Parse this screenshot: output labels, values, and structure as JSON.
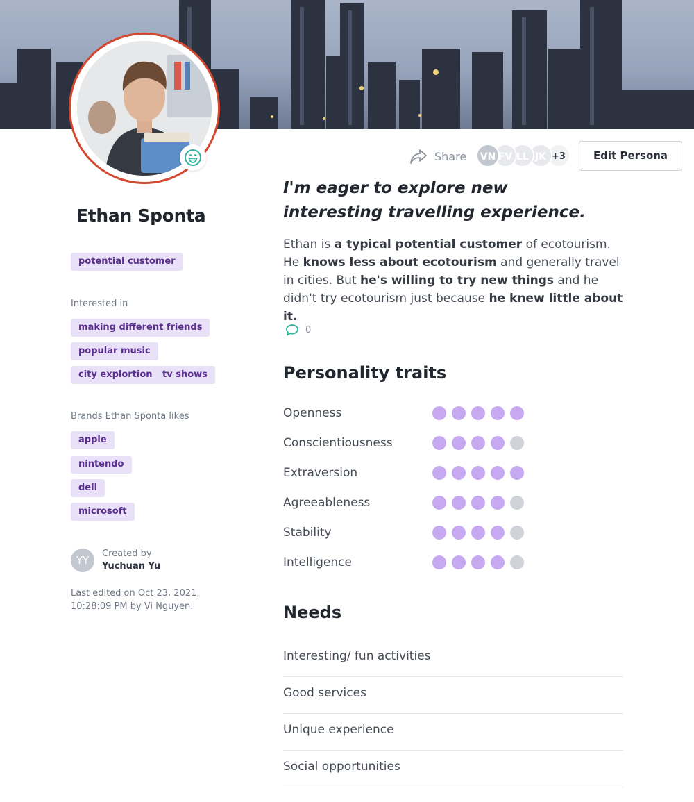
{
  "profile": {
    "name": "Ethan Sponta",
    "type_tag": "potential customer",
    "interested_label": "Interested in",
    "interests": [
      "making different friends",
      "popular music",
      "city explortion",
      "tv shows"
    ],
    "brands_label": "Brands Ethan Sponta likes",
    "brands": [
      "apple",
      "nintendo",
      "dell",
      "microsoft"
    ],
    "mood_icon": "grin-face-icon"
  },
  "creator": {
    "initials": "YY",
    "label": "Created by",
    "name": "Yuchuan Yu",
    "edited": "Last edited on Oct 23, 2021, 10:28:09 PM by Vi Nguyen."
  },
  "toolbar": {
    "share_label": "Share",
    "collaborators": [
      {
        "initials": "VN",
        "color": "#c3c8d0"
      },
      {
        "initials": "FV",
        "color": "#e7e9ec"
      },
      {
        "initials": "LL",
        "color": "#e7e9ec"
      },
      {
        "initials": "JK",
        "color": "#e7e9ec"
      }
    ],
    "more_count": "+3",
    "edit_label": "Edit Persona"
  },
  "quote": "I'm eager to explore new interesting travelling experience.",
  "description": {
    "s1": "Ethan is ",
    "b1": "a typical potential customer",
    "s2": " of ecotourism. He ",
    "b2": "knows less about ecotourism",
    "s3": " and generally travel in cities. But ",
    "b3": "he's willing to try new things",
    "s4": " and he didn't try ecotourism just because ",
    "b4": "he knew little about it."
  },
  "comments": {
    "count": "0"
  },
  "personality": {
    "title": "Personality traits",
    "max": 5,
    "filled_color": "#c6a9f0",
    "empty_color": "#cfd3d9",
    "traits": [
      {
        "name": "Openness",
        "score": 5
      },
      {
        "name": "Conscientiousness",
        "score": 4
      },
      {
        "name": "Extraversion",
        "score": 5
      },
      {
        "name": "Agreeableness",
        "score": 4
      },
      {
        "name": "Stability",
        "score": 4
      },
      {
        "name": "Intelligence",
        "score": 4
      }
    ]
  },
  "needs": {
    "title": "Needs",
    "items": [
      "Interesting/ fun activities",
      "Good services",
      "Unique experience",
      "Social opportunities"
    ]
  },
  "colors": {
    "accent_ring": "#d4472f",
    "tag_bg": "#e9e1f7",
    "tag_text": "#5b2f8f",
    "comment_icon": "#2bb59a"
  }
}
